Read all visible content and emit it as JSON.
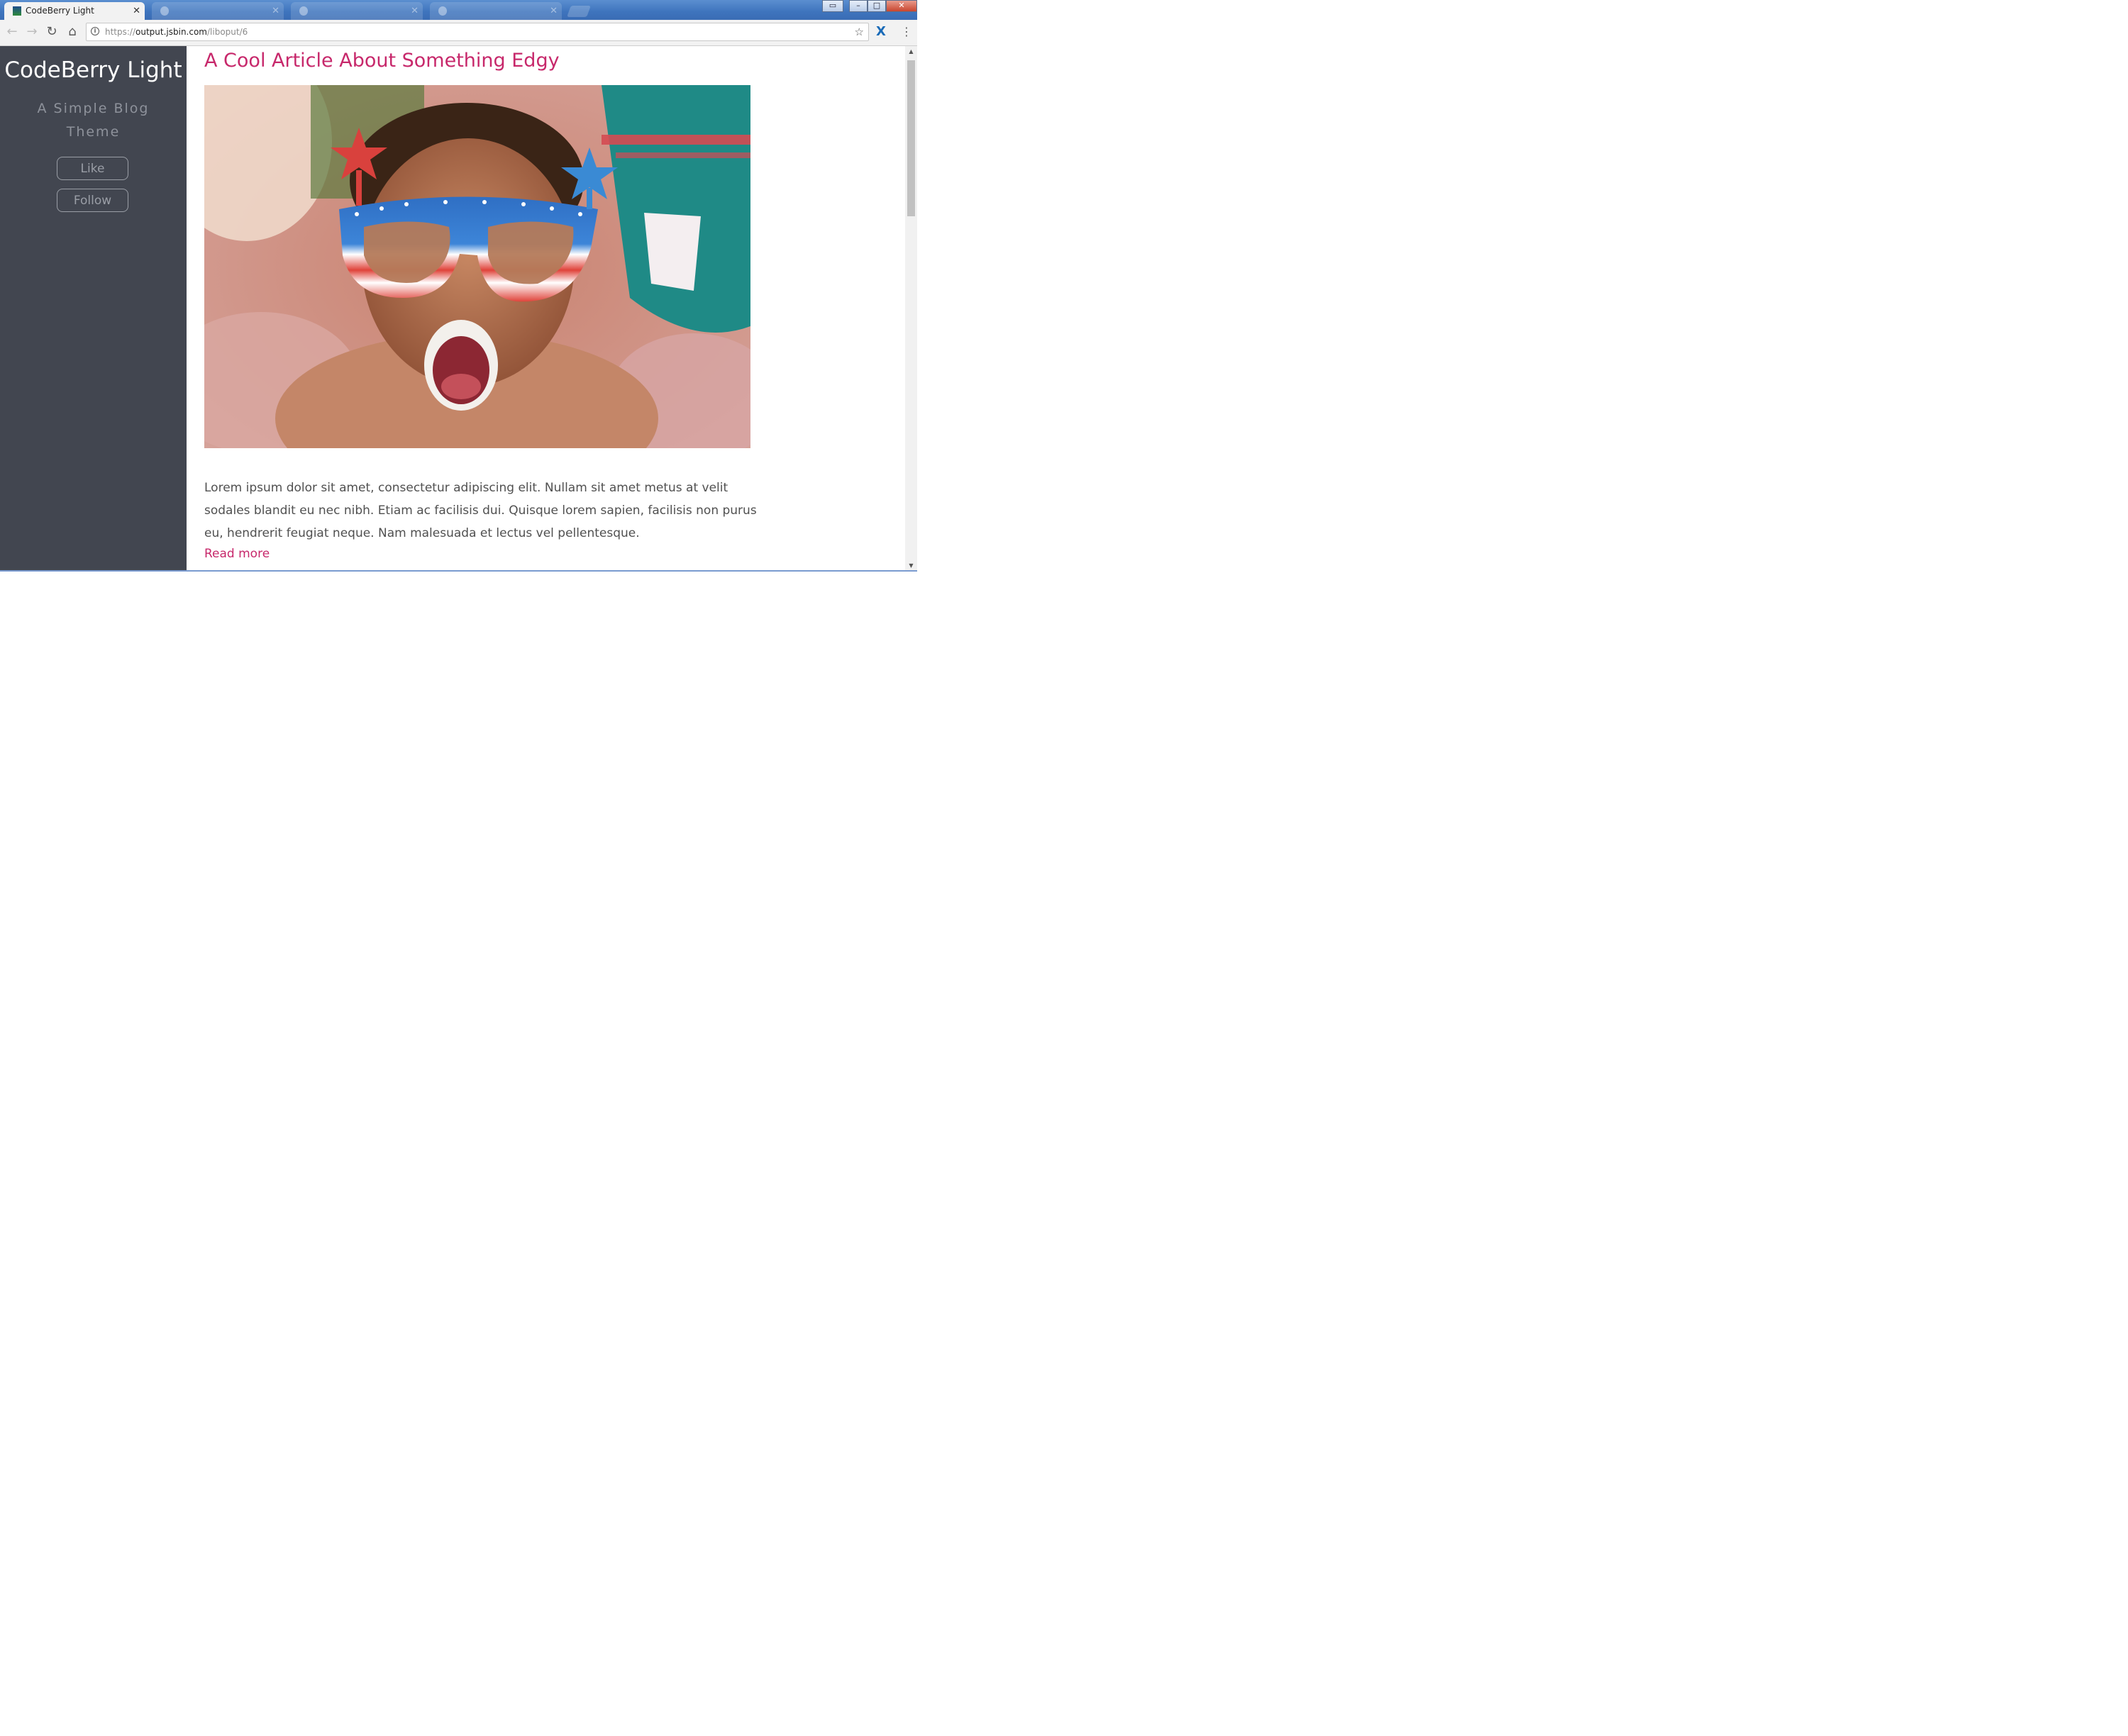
{
  "browser": {
    "active_tab": {
      "title": "CodeBerry Light"
    },
    "inactive_tabs": [
      {
        "title": ""
      },
      {
        "title": ""
      },
      {
        "title": ""
      }
    ],
    "url": {
      "scheme": "https://",
      "host": "output.jsbin.com",
      "path": "/liboput/6"
    }
  },
  "sidebar": {
    "title": "CodeBerry Light",
    "subtitle": "A Simple Blog Theme",
    "like_label": "Like",
    "follow_label": "Follow"
  },
  "post": {
    "title": "A Cool Article About Something Edgy",
    "body": "Lorem ipsum dolor sit amet, consectetur adipiscing elit. Nullam sit amet metus at velit sodales blandit eu nec nibh. Etiam ac facilisis dui. Quisque lorem sapien, facilisis non purus eu, hendrerit feugiat neque. Nam malesuada et lectus vel pellentesque.",
    "read_more": "Read more"
  },
  "colors": {
    "sidebar_bg": "#424650",
    "accent": "#c7286b",
    "body_text": "#505050"
  }
}
